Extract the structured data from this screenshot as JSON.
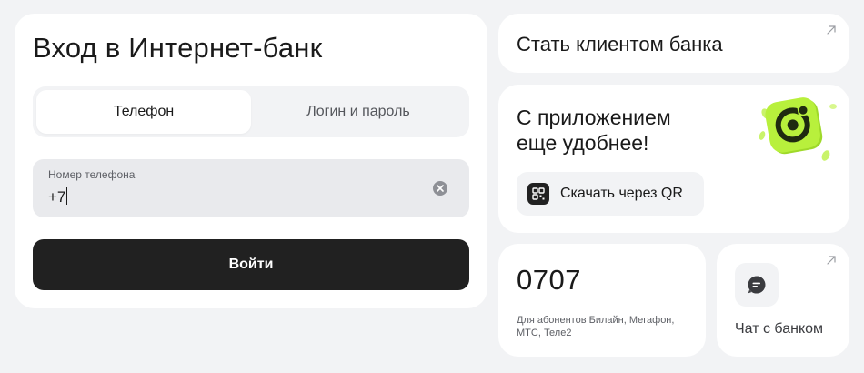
{
  "login": {
    "title": "Вход в Интернет-банк",
    "tabs": [
      {
        "label": "Телефон",
        "active": true
      },
      {
        "label": "Логин и пароль",
        "active": false
      }
    ],
    "phone_field": {
      "label": "Номер телефона",
      "value": "+7"
    },
    "submit_label": "Войти"
  },
  "become_client": {
    "title": "Стать клиентом банка",
    "icon": "arrow-up-right-icon"
  },
  "app_promo": {
    "title_lines": [
      "С приложением",
      "еще удобнее!"
    ],
    "logo_color": "#b8f03c",
    "qr_button": {
      "label": "Скачать через QR",
      "icon": "qr-code-icon"
    }
  },
  "short_number": {
    "number": "0707",
    "description": "Для абонентов Билайн, Мегафон, МТС, Теле2"
  },
  "chat": {
    "label": "Чат с банком",
    "icon": "chat-bubble-icon"
  },
  "colors": {
    "background": "#f2f3f5",
    "card": "#ffffff",
    "primary_button": "#212121",
    "accent_lime": "#b8f03c"
  }
}
